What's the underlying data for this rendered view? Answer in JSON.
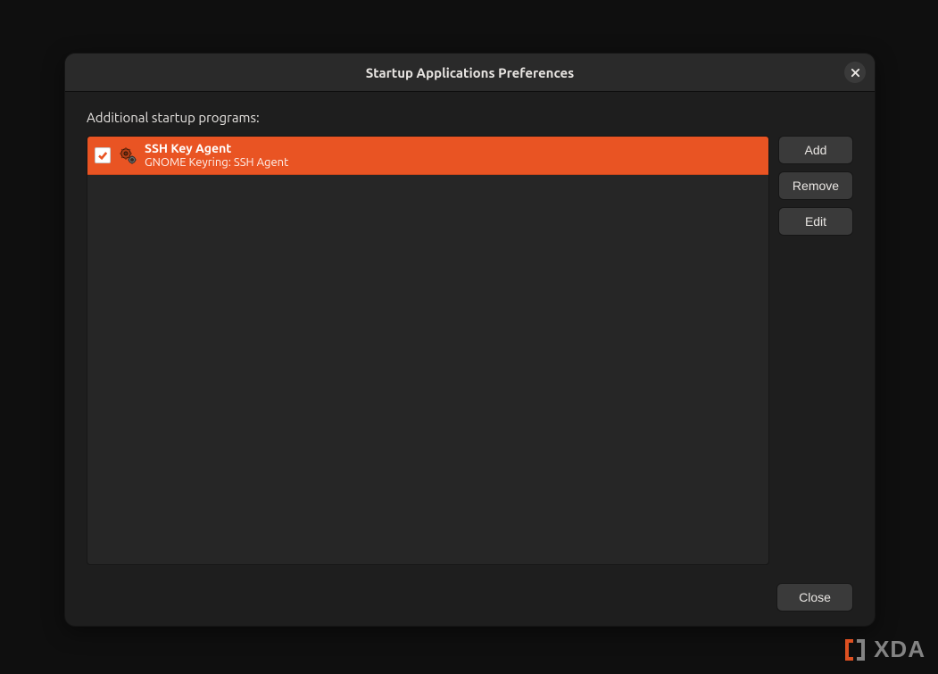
{
  "window": {
    "title": "Startup Applications Preferences",
    "close_icon": "close-icon"
  },
  "main": {
    "list_label": "Additional startup programs:",
    "items": [
      {
        "checked": true,
        "title": "SSH Key Agent",
        "subtitle": "GNOME Keyring: SSH Agent",
        "icon": "gears-icon"
      }
    ]
  },
  "buttons": {
    "add": "Add",
    "remove": "Remove",
    "edit": "Edit",
    "close": "Close"
  },
  "watermark": {
    "text": "XDA"
  },
  "colors": {
    "accent": "#e95423",
    "window_bg": "#1e1e1e",
    "desktop_bg": "#0f0f0f"
  }
}
